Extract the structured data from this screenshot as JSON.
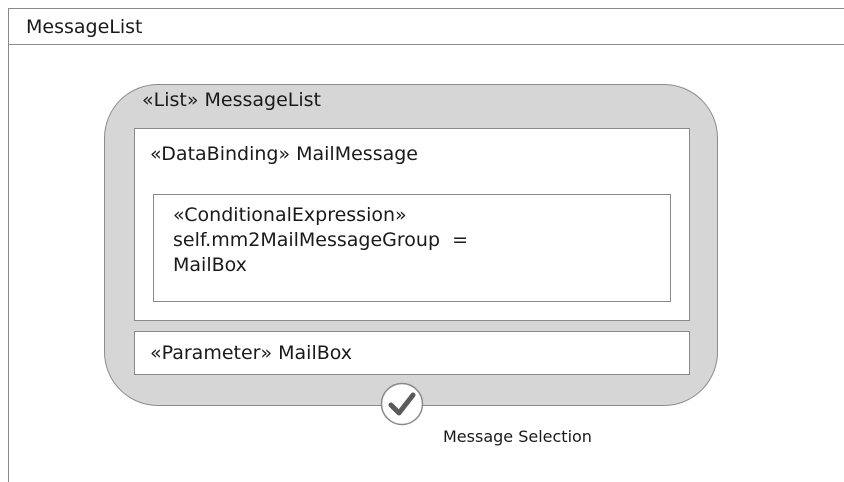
{
  "frame": {
    "title": "MessageList"
  },
  "list": {
    "title": "«List» MessageList"
  },
  "binding": {
    "title": "«DataBinding» MailMessage"
  },
  "condition": {
    "lines": [
      "«ConditionalExpression»",
      "self.mm2MailMessageGroup  =",
      "MailBox"
    ]
  },
  "parameter": {
    "label": "«Parameter» MailBox"
  },
  "selection": {
    "icon": "checkmark-icon",
    "label": "Message Selection"
  }
}
